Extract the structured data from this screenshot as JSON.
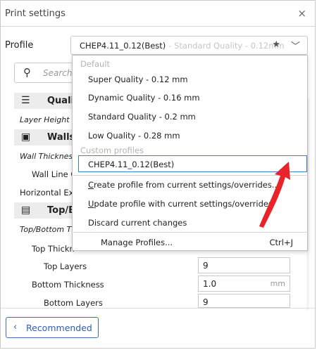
{
  "window": {
    "title": "Print settings",
    "close_glyph": "×"
  },
  "profile": {
    "label": "Profile",
    "current": "CHEP4.11_0.12(Best)",
    "current_sub": "- Standard Quality - 0.12mm",
    "star_icon": "star-icon",
    "chevron_icon": "chevron-down-icon"
  },
  "search": {
    "placeholder": "Search"
  },
  "sections": [
    {
      "label": "Quali"
    },
    {
      "label": "Walls"
    },
    {
      "label": "Top/B"
    }
  ],
  "settings": {
    "layer_height": "Layer Height",
    "wall_thickness": "Wall Thickness",
    "wall_line_count": "Wall Line C",
    "horizontal_expansion": "Horizontal Exp",
    "top_bottom_thickness": "Top/Bottom Th",
    "top_thickness": "Top Thickn",
    "top_layers": {
      "label": "Top Layers",
      "value": "9"
    },
    "bottom_thickness": {
      "label": "Bottom Thickness",
      "value": "1.0",
      "unit": "mm"
    },
    "bottom_layers": {
      "label": "Bottom Layers",
      "value": "9"
    }
  },
  "menu": {
    "group_default": "Default",
    "default_items": [
      "Super Quality - 0.12 mm",
      "Dynamic Quality - 0.16 mm",
      "Standard Quality - 0.2 mm",
      "Low Quality - 0.28 mm"
    ],
    "group_custom": "Custom profiles",
    "custom_item": "CHEP4.11_0.12(Best)",
    "create_first": "C",
    "create_rest": "reate profile from current settings/overrides...",
    "update_first": "U",
    "update_rest": "pdate profile with current settings/overrides",
    "discard": "Discard current changes",
    "manage": "Manage Profiles...",
    "manage_shortcut": "Ctrl+J"
  },
  "footer": {
    "recommended": "Recommended",
    "chevron": "‹"
  },
  "colors": {
    "accent": "#3c7fd6",
    "arrow": "#e8232a"
  }
}
